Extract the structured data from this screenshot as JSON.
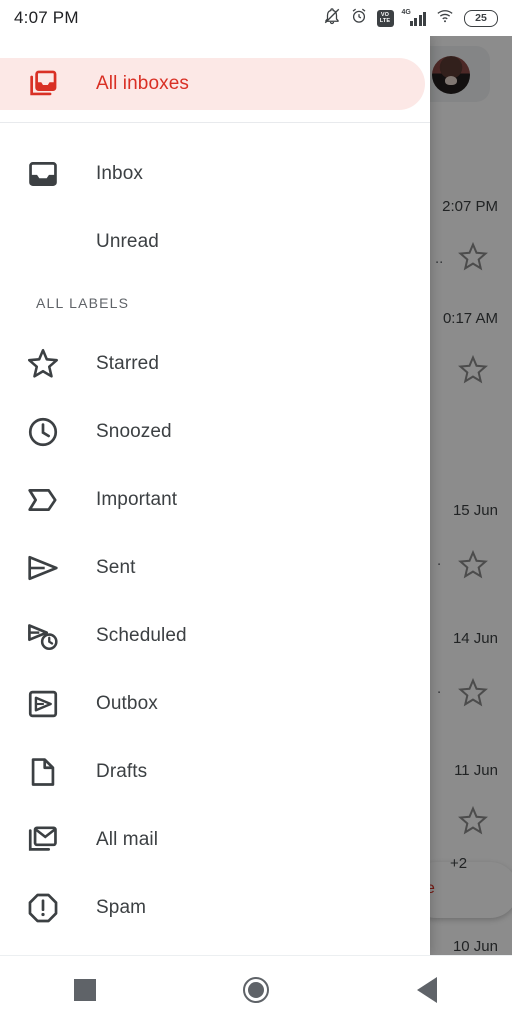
{
  "status_bar": {
    "time": "4:07 PM",
    "icons": [
      {
        "name": "notifications-off-icon",
        "label": "silent"
      },
      {
        "name": "alarm-icon",
        "label": "alarm"
      },
      {
        "name": "volte-icon",
        "label": "VoLTE",
        "line1": "VO",
        "line2": "LTE"
      },
      {
        "name": "signal-4g-icon",
        "label": "4G",
        "network": "4G"
      },
      {
        "name": "wifi-icon",
        "label": "wifi"
      },
      {
        "name": "battery-icon",
        "label": "battery",
        "level": "25"
      }
    ]
  },
  "drawer": {
    "selected_item": "All inboxes",
    "primary": [
      {
        "id": "all-inboxes",
        "label": "All inboxes",
        "icon": "all-inboxes-icon",
        "selected": true
      },
      {
        "id": "inbox",
        "label": "Inbox",
        "icon": "inbox-icon",
        "selected": false
      },
      {
        "id": "unread",
        "label": "Unread",
        "icon": "none",
        "selected": false
      }
    ],
    "section_header": "ALL LABELS",
    "labels": [
      {
        "id": "starred",
        "label": "Starred",
        "icon": "star-icon"
      },
      {
        "id": "snoozed",
        "label": "Snoozed",
        "icon": "clock-icon"
      },
      {
        "id": "important",
        "label": "Important",
        "icon": "important-label-icon"
      },
      {
        "id": "sent",
        "label": "Sent",
        "icon": "send-icon"
      },
      {
        "id": "scheduled",
        "label": "Scheduled",
        "icon": "scheduled-send-icon"
      },
      {
        "id": "outbox",
        "label": "Outbox",
        "icon": "outbox-icon"
      },
      {
        "id": "drafts",
        "label": "Drafts",
        "icon": "draft-document-icon"
      },
      {
        "id": "all-mail",
        "label": "All mail",
        "icon": "all-mail-icon"
      },
      {
        "id": "spam",
        "label": "Spam",
        "icon": "spam-icon"
      }
    ]
  },
  "background_mail_list": {
    "avatar": "account-avatar",
    "compose_fab_label": "e",
    "attachment_badge": "+2",
    "rows": [
      {
        "time": "2:07 PM",
        "snippet": ".."
      },
      {
        "time": "0:17 AM",
        "snippet": ""
      },
      {
        "time": "15 Jun",
        "snippet": "."
      },
      {
        "time": "14 Jun",
        "snippet": "."
      },
      {
        "time": "11 Jun",
        "snippet": ""
      },
      {
        "time": "10 Jun",
        "snippet": ""
      }
    ]
  },
  "system_nav": {
    "recents_label": "Recents",
    "home_label": "Home",
    "back_label": "Back"
  },
  "colors": {
    "accent": "#d93025",
    "selected_pill": "#fce8e6",
    "text_primary": "#3c4043",
    "text_secondary": "#5f6368",
    "surface": "#ffffff"
  }
}
